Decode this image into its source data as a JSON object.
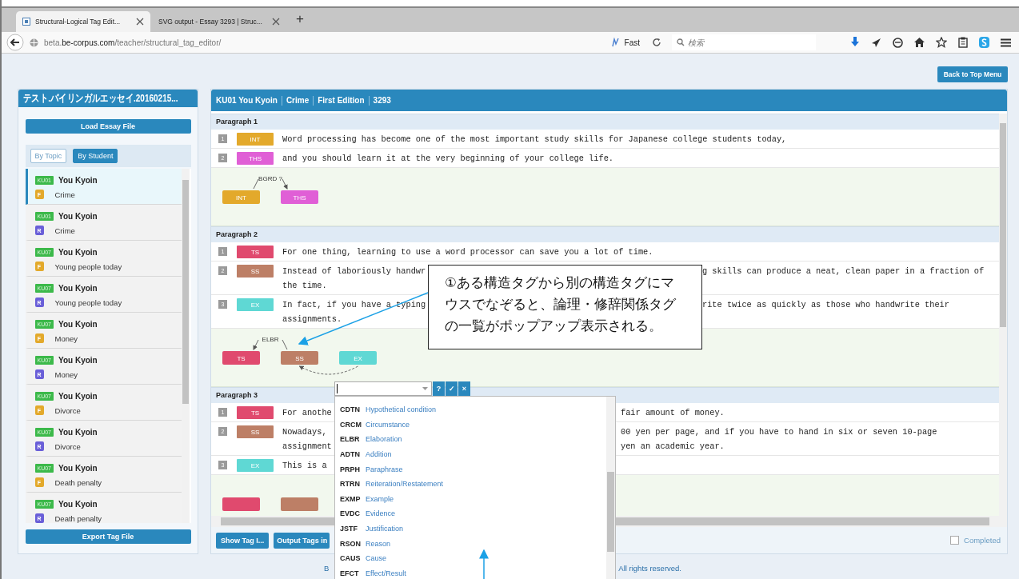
{
  "browser": {
    "tabs": [
      {
        "title": "Structural-Logical Tag Edit...",
        "selected": true
      },
      {
        "title": "SVG output - Essay 3293 | Struc...",
        "selected": false
      }
    ],
    "new_tab": "+",
    "url": {
      "subdomain": "beta.",
      "domain": "be-corpus.com",
      "path": "/teacher/structural_tag_editor/"
    },
    "speed_label": "Fast",
    "search": {
      "placeholder": "検索"
    }
  },
  "top_button": "Back to Top Menu",
  "sidebar": {
    "title": "テスト.バイリンガルエッセイ.20160215...",
    "load_button": "Load Essay File",
    "filters": [
      {
        "label": "By Topic",
        "selected": false
      },
      {
        "label": "By Student",
        "selected": true
      }
    ],
    "essays": [
      {
        "code": "KU01",
        "name": "You Kyoin",
        "version": "F",
        "color": "#e3a92b",
        "topic": "Crime",
        "selected": true
      },
      {
        "code": "KU01",
        "name": "You Kyoin",
        "version": "R",
        "color": "#6a5fd8",
        "topic": "Crime",
        "selected": false
      },
      {
        "code": "KU07",
        "name": "You Kyoin",
        "version": "F",
        "color": "#e3a92b",
        "topic": "Young people today",
        "selected": false
      },
      {
        "code": "KU07",
        "name": "You Kyoin",
        "version": "R",
        "color": "#6a5fd8",
        "topic": "Young people today",
        "selected": false
      },
      {
        "code": "KU07",
        "name": "You Kyoin",
        "version": "F",
        "color": "#e3a92b",
        "topic": "Money",
        "selected": false
      },
      {
        "code": "KU07",
        "name": "You Kyoin",
        "version": "R",
        "color": "#6a5fd8",
        "topic": "Money",
        "selected": false
      },
      {
        "code": "KU07",
        "name": "You Kyoin",
        "version": "F",
        "color": "#e3a92b",
        "topic": "Divorce",
        "selected": false
      },
      {
        "code": "KU07",
        "name": "You Kyoin",
        "version": "R",
        "color": "#6a5fd8",
        "topic": "Divorce",
        "selected": false
      },
      {
        "code": "KU07",
        "name": "You Kyoin",
        "version": "F",
        "color": "#e3a92b",
        "topic": "Death penalty",
        "selected": false
      },
      {
        "code": "KU07",
        "name": "You Kyoin",
        "version": "R",
        "color": "#6a5fd8",
        "topic": "Death penalty",
        "selected": false
      }
    ],
    "export_button": "Export Tag File"
  },
  "essay_header": [
    "KU01 You Kyoin",
    "Crime",
    "First Edition",
    "3293"
  ],
  "paragraphs": [
    {
      "title": "Paragraph 1",
      "sentences": [
        {
          "number": "1",
          "tag": "INT",
          "color": "#e3a92b",
          "lines": [
            {
              "left": "Word processing has become one of the most important study skills for Japanese college students today,"
            }
          ]
        },
        {
          "number": "2",
          "tag": "THS",
          "color": "#e05fd6",
          "lines": [
            {
              "left": "and you should learn it at the very beginning of your college life."
            }
          ]
        }
      ],
      "graph": {
        "nodes": [
          {
            "label": "INT",
            "color": "#e3a92b"
          },
          {
            "label": "THS",
            "color": "#e05fd6"
          }
        ],
        "relations": [
          {
            "reversed": false,
            "label": "BGRD ?",
            "kind": "solid"
          }
        ]
      }
    },
    {
      "title": "Paragraph 2",
      "sentences": [
        {
          "number": "1",
          "tag": "TS",
          "color": "#e04a6e",
          "lines": [
            {
              "left": "For one thing, learning to use a word processor can save you a lot of time."
            }
          ]
        },
        {
          "number": "2",
          "tag": "SS",
          "color": "#bd7f66",
          "lines": [
            {
              "left": "Instead of laboriously handwr",
              "right": "g skills can produce a neat, clean paper in a fraction of"
            },
            {
              "left": "the time."
            }
          ]
        },
        {
          "number": "3",
          "tag": "EX",
          "color": "#5fd8d4",
          "lines": [
            {
              "left": "In fact, if you have a typing",
              "right": "rite twice as quickly as those who handwrite their"
            },
            {
              "left": "assignments."
            }
          ]
        }
      ],
      "graph": {
        "nodes": [
          {
            "label": "TS",
            "color": "#e04a6e"
          },
          {
            "label": "SS",
            "color": "#bd7f66"
          },
          {
            "label": "EX",
            "color": "#5fd8d4"
          }
        ],
        "relations": [
          {
            "reversed": true,
            "label": "ELBR",
            "kind": "solid"
          },
          {
            "reversed": true,
            "kind": "dashed"
          }
        ]
      }
    },
    {
      "title": "Paragraph 3",
      "sentences": [
        {
          "number": "1",
          "tag": "TS",
          "color": "#e04a6e",
          "lines": [
            {
              "left": "For anothe",
              "right": "fair amount of money."
            }
          ]
        },
        {
          "number": "2",
          "tag": "SS",
          "color": "#bd7f66",
          "lines": [
            {
              "left": "Nowadays,",
              "right": "00 yen per page, and if you have to hand in six or seven 10-page"
            },
            {
              "left": "assignment",
              "right": "yen an academic year."
            }
          ]
        },
        {
          "number": "3",
          "tag": "EX",
          "color": "#5fd8d4",
          "lines": [
            {
              "left": "This is a"
            }
          ]
        }
      ],
      "graph": {
        "nodes": [
          {
            "color": "#e04a6e"
          },
          {
            "color": "#bd7f66"
          }
        ]
      }
    }
  ],
  "bottom_buttons": [
    "Show Tag I...",
    "Output Tags in"
  ],
  "completed": {
    "label": "Completed",
    "checked": false
  },
  "footer": [
    "B",
    "All rights reserved."
  ],
  "relation_menu": {
    "buttons": [
      "?",
      "✓",
      "×"
    ],
    "options": [
      {
        "code": "CDTN",
        "label": "Hypothetical condition"
      },
      {
        "code": "CRCM",
        "label": "Circumstance"
      },
      {
        "code": "ELBR",
        "label": "Elaboration"
      },
      {
        "code": "ADTN",
        "label": "Addition"
      },
      {
        "code": "PRPH",
        "label": "Paraphrase"
      },
      {
        "code": "RTRN",
        "label": "Reiteration/Restatement"
      },
      {
        "code": "EXMP",
        "label": "Example"
      },
      {
        "code": "EVDC",
        "label": "Evidence"
      },
      {
        "code": "JSTF",
        "label": "Justification"
      },
      {
        "code": "RSON",
        "label": "Reason"
      },
      {
        "code": "CAUS",
        "label": "Cause"
      },
      {
        "code": "EFCT",
        "label": "Effect/Result"
      }
    ]
  },
  "annotation": {
    "text": "①ある構造タグから別の構造タグにマウスでなぞると、論理・修辞関係タグの一覧がポップアップ表示される。"
  }
}
